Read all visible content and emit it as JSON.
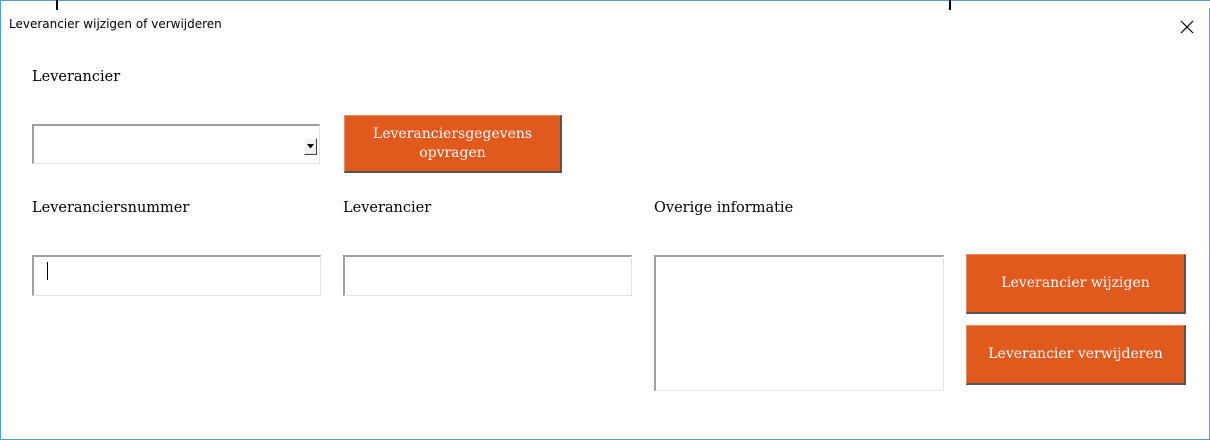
{
  "window": {
    "title": "Leverancier wijzigen of verwijderen",
    "accent_color": "#5b9bd5",
    "close_icon": "close-icon"
  },
  "selector": {
    "label": "Leverancier",
    "dropdown_value": "",
    "dropdown_icon": "chevron-down-icon",
    "fetch_button_label": "Leveranciersgegevens opvragen"
  },
  "form": {
    "supplier_number_label": "Leveranciersnummer",
    "supplier_number_value": "",
    "supplier_name_label": "Leverancier",
    "supplier_name_value": "",
    "other_info_label": "Overige informatie",
    "other_info_value": ""
  },
  "actions": {
    "edit_button_label": "Leverancier wijzigen",
    "delete_button_label": "Leverancier verwijderen",
    "button_color": "#e05a1e"
  }
}
